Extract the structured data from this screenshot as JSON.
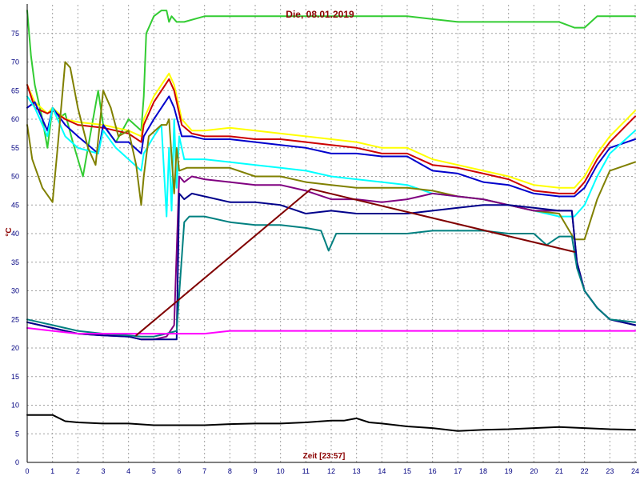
{
  "chart_data": {
    "type": "line",
    "title": "Die, 08.01.2019",
    "xlabel": "Zeit [23:57]",
    "ylabel": "°C",
    "xlim": [
      0,
      24
    ],
    "ylim": [
      0,
      80
    ],
    "x_ticks": [
      0,
      1,
      2,
      3,
      4,
      5,
      6,
      7,
      8,
      9,
      10,
      11,
      12,
      13,
      14,
      15,
      16,
      17,
      18,
      19,
      20,
      21,
      22,
      23,
      24
    ],
    "y_ticks": [
      0,
      5,
      10,
      15,
      20,
      25,
      30,
      35,
      40,
      45,
      50,
      55,
      60,
      65,
      70,
      75
    ],
    "grid": true,
    "legend": "none",
    "series": [
      {
        "color": "#33cc33",
        "x": [
          0,
          0.15,
          0.3,
          0.6,
          0.8,
          1.0,
          1.2,
          1.5,
          1.8,
          2.2,
          2.6,
          2.8,
          3.0,
          3.5,
          4.0,
          4.5,
          4.6,
          4.7,
          5.0,
          5.3,
          5.5,
          5.6,
          5.7,
          5.9,
          6.2,
          7,
          8,
          9,
          10,
          11,
          12,
          13,
          14,
          15,
          16,
          17,
          18,
          19,
          20,
          21,
          21.6,
          22,
          22.5,
          23,
          24
        ],
        "y": [
          79,
          71,
          66,
          60,
          55,
          62,
          60,
          61,
          56,
          50,
          60,
          65,
          59,
          56,
          60,
          58,
          64,
          75,
          78,
          79,
          79,
          77,
          78,
          77,
          77,
          78,
          78,
          78,
          78,
          78,
          78,
          78,
          78,
          78,
          77.5,
          77,
          77,
          77,
          77,
          77,
          76,
          76,
          78,
          78,
          78
        ]
      },
      {
        "color": "#ffff00",
        "x": [
          0,
          0.3,
          0.8,
          1.0,
          1.5,
          2,
          3,
          3.5,
          4,
          4.5,
          4.6,
          5,
          5.3,
          5.6,
          5.8,
          6.1,
          6.5,
          7,
          8,
          9,
          10,
          11,
          12,
          13,
          14,
          15,
          16,
          17,
          18,
          19,
          20,
          21,
          21.6,
          22,
          22.5,
          23,
          24
        ],
        "y": [
          66,
          63,
          61,
          62,
          60,
          59.5,
          59,
          58.5,
          58,
          57,
          60,
          64,
          66,
          68,
          66,
          60,
          58,
          58,
          58.5,
          58,
          57.5,
          57,
          56.5,
          56,
          55,
          55,
          53,
          52,
          51,
          50,
          48.5,
          48,
          48,
          50,
          54,
          57,
          61.5
        ]
      },
      {
        "color": "#cc0000",
        "x": [
          0,
          0.3,
          0.8,
          1.0,
          1.5,
          2,
          3,
          3.5,
          4,
          4.5,
          4.6,
          5,
          5.3,
          5.6,
          5.8,
          6.1,
          6.5,
          7,
          8,
          9,
          10,
          11,
          12,
          13,
          14,
          15,
          16,
          17,
          18,
          19,
          20,
          21,
          21.6,
          22,
          22.5,
          23,
          24
        ],
        "y": [
          66,
          62,
          61,
          61.5,
          60,
          59,
          58.5,
          58,
          57.5,
          56,
          59,
          63,
          65,
          67,
          65,
          59,
          57.5,
          57,
          57,
          56.5,
          56.5,
          56,
          55.5,
          55,
          54,
          54,
          52,
          51.5,
          50.5,
          49.5,
          47.5,
          47,
          47,
          49,
          53,
          56,
          60.5
        ]
      },
      {
        "color": "#0000cc",
        "x": [
          0,
          0.3,
          0.8,
          1.0,
          1.5,
          2,
          2.8,
          3,
          3.5,
          4,
          4.5,
          4.6,
          5,
          5.3,
          5.6,
          5.8,
          6.1,
          6.5,
          7,
          8,
          9,
          10,
          11,
          12,
          13,
          14,
          15,
          16,
          17,
          18,
          19,
          20,
          21,
          21.6,
          22,
          22.5,
          23,
          24
        ],
        "y": [
          62,
          63,
          58,
          62,
          59,
          57,
          54,
          59,
          56,
          56,
          54,
          57,
          60,
          62,
          64,
          62,
          57,
          57,
          56.5,
          56.5,
          56,
          55.5,
          55,
          54,
          54,
          53.5,
          53.5,
          51,
          50.5,
          49,
          48.5,
          47,
          46.5,
          46.5,
          48,
          52,
          55,
          56.5
        ]
      },
      {
        "color": "#00ffff",
        "x": [
          0,
          0.3,
          0.8,
          1.0,
          1.5,
          2,
          2.8,
          3,
          3.5,
          4,
          4.5,
          4.6,
          5,
          5.3,
          5.5,
          5.6,
          5.7,
          5.8,
          5.9,
          6.0,
          6.2,
          7,
          8,
          9,
          10,
          11,
          12,
          13,
          14,
          15,
          16,
          17,
          18,
          19,
          20,
          21,
          21.6,
          22,
          22.5,
          23,
          24
        ],
        "y": [
          64,
          62,
          57,
          62,
          57,
          55,
          54,
          58,
          55,
          53,
          51,
          54,
          57,
          59,
          43,
          55,
          44,
          60,
          48,
          57,
          53,
          53,
          52.5,
          52,
          51.5,
          51,
          50,
          49.5,
          49,
          48.5,
          47,
          46.5,
          46,
          45,
          44,
          43,
          43,
          45,
          50,
          54,
          58
        ]
      },
      {
        "color": "#808000",
        "x": [
          0,
          0.2,
          0.6,
          1.0,
          1.2,
          1.5,
          1.7,
          2.0,
          2.4,
          2.7,
          3.0,
          3.3,
          3.6,
          4.0,
          4.3,
          4.5,
          4.6,
          4.8,
          5.3,
          5.5,
          5.6,
          5.8,
          5.9,
          6.0,
          6.3,
          6.5,
          7,
          8,
          9,
          10,
          11,
          12,
          13,
          14,
          15,
          16,
          17,
          18,
          19,
          20,
          21,
          21.6,
          22,
          22.5,
          23,
          24
        ],
        "y": [
          59,
          53,
          48,
          45.5,
          55,
          70,
          69,
          62,
          55,
          52,
          65,
          62,
          57,
          58,
          52,
          45,
          50,
          57,
          59,
          59,
          60,
          47,
          55,
          51,
          51.5,
          51.5,
          51.5,
          51.5,
          50,
          50,
          49,
          48.5,
          48,
          48,
          48,
          47.5,
          46.5,
          46,
          45,
          44,
          43.5,
          39,
          39,
          46,
          51,
          52.5
        ]
      },
      {
        "color": "#800080",
        "x": [
          0,
          1,
          2,
          3,
          4,
          4.5,
          5,
          5.5,
          5.8,
          6.0,
          6.2,
          6.5,
          7,
          8,
          9,
          10,
          11,
          12,
          13,
          14,
          15,
          16,
          17,
          18,
          19,
          20,
          21,
          21.5,
          21.7,
          22,
          22.5,
          23,
          24
        ],
        "y": [
          24.5,
          23.5,
          22.5,
          22.2,
          22,
          21.5,
          21.5,
          22,
          24,
          50,
          49,
          50,
          49.5,
          49,
          48.5,
          48.5,
          47.5,
          46,
          46,
          45.5,
          46,
          47,
          46.5,
          46,
          45,
          44,
          44,
          44,
          35,
          30,
          27,
          25,
          24
        ]
      },
      {
        "color": "#00008b",
        "x": [
          0,
          1,
          2,
          3,
          4,
          4.5,
          5,
          5.5,
          5.9,
          6.0,
          6.2,
          6.5,
          7,
          8,
          9,
          10,
          11,
          12,
          13,
          14,
          15,
          16,
          17,
          18,
          19,
          20,
          21,
          21.5,
          21.7,
          22,
          22.5,
          23,
          24
        ],
        "y": [
          24.5,
          23.5,
          22.5,
          22.2,
          22,
          21.5,
          21.5,
          21.5,
          21.5,
          47,
          46,
          47,
          46.5,
          45.5,
          45.5,
          45,
          43.5,
          44,
          43.5,
          43.5,
          43.5,
          44,
          44.5,
          45,
          45,
          44.5,
          44,
          44,
          35,
          30,
          27,
          25,
          24
        ]
      },
      {
        "color": "#008080",
        "x": [
          0,
          1,
          2,
          3,
          4,
          4.5,
          5,
          5.5,
          5.9,
          6.2,
          6.4,
          7,
          8,
          9,
          10,
          11,
          11.6,
          11.9,
          12.2,
          13,
          14,
          15,
          16,
          17,
          18,
          19,
          20,
          20.5,
          21,
          21.5,
          21.7,
          22,
          22.5,
          23,
          24
        ],
        "y": [
          25,
          24,
          23,
          22.5,
          22.2,
          22,
          22,
          22.5,
          23,
          42,
          43,
          43,
          42,
          41.5,
          41.5,
          41,
          40.5,
          37,
          40,
          40,
          40,
          40,
          40.5,
          40.5,
          40.5,
          40,
          40,
          38,
          39.5,
          39.5,
          34,
          30,
          27,
          25,
          24.5
        ]
      },
      {
        "color": "#ff00ff",
        "x": [
          0,
          1,
          2,
          3,
          4,
          5,
          6,
          7,
          8,
          9,
          10,
          11,
          12,
          13,
          14,
          15,
          16,
          17,
          18,
          19,
          20,
          21,
          22,
          23,
          24
        ],
        "y": [
          23.5,
          23,
          22.5,
          22.5,
          22.5,
          22.5,
          22.5,
          22.5,
          23,
          23,
          23,
          23,
          23,
          23,
          23,
          23,
          23,
          23,
          23,
          23,
          23,
          23,
          23,
          23,
          23
        ]
      },
      {
        "color": "#800000",
        "x": [
          4.3,
          11.2,
          21.6
        ],
        "y": [
          22.2,
          47.8,
          36.8
        ]
      },
      {
        "color": "#000000",
        "x": [
          0,
          0.5,
          1,
          1.5,
          2,
          3,
          4,
          5,
          6,
          7,
          8,
          9,
          10,
          11,
          12,
          12.5,
          13,
          13.5,
          14,
          15,
          16,
          17,
          18,
          19,
          20,
          21,
          22,
          23,
          24
        ],
        "y": [
          8.3,
          8.3,
          8.3,
          7.2,
          7,
          6.8,
          6.8,
          6.5,
          6.5,
          6.5,
          6.7,
          6.8,
          6.8,
          7,
          7.3,
          7.3,
          7.7,
          7,
          6.8,
          6.3,
          6,
          5.5,
          5.7,
          5.8,
          6,
          6.2,
          6,
          5.8,
          5.7
        ]
      }
    ]
  }
}
